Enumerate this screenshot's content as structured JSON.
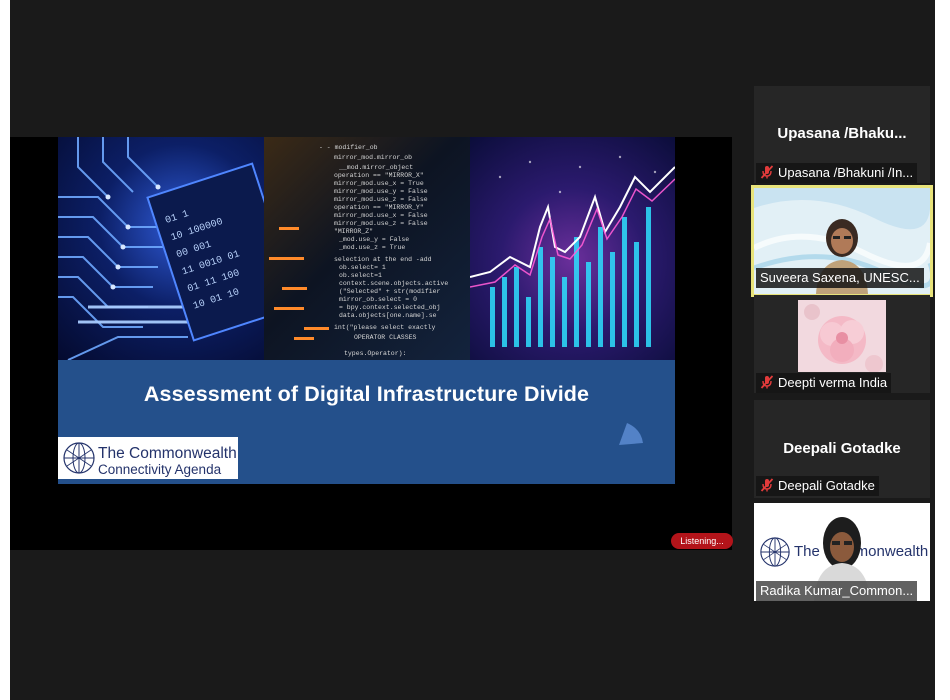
{
  "shared_screen": {
    "slide_title": "Assessment of Digital Infrastructure Divide",
    "logo_line1": "The Commonwealth",
    "logo_line2": "Connectivity Agenda",
    "status_badge": "Listening..."
  },
  "participants": [
    {
      "heading": "Upasana  /Bhaku...",
      "label": "Upasana /Bhakuni /In...",
      "muted": true,
      "video": false
    },
    {
      "label": "Suveera Saxena, UNESC...",
      "muted": false,
      "video": true,
      "active_speaker": true
    },
    {
      "label": "Deepti verma India",
      "muted": true,
      "video": false,
      "avatar": "flower-photo"
    },
    {
      "heading": "Deepali Gotadke",
      "label": "Deepali Gotadke",
      "muted": true,
      "video": false
    },
    {
      "label": "Radika Kumar_Common...",
      "muted": false,
      "video": true,
      "background_text": "The Commonwealth"
    }
  ],
  "colors": {
    "active_speaker_border": "#e8e37a",
    "muted_icon": "#e23b3b",
    "slide_band": "#24508b"
  }
}
